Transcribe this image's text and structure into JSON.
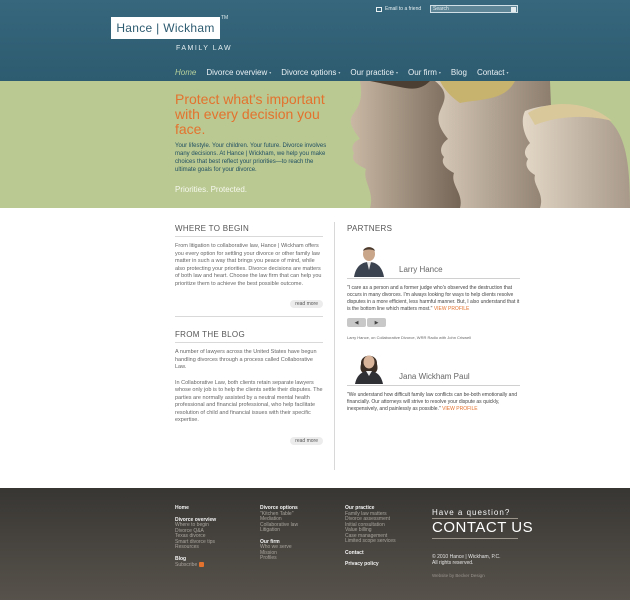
{
  "header": {
    "logo_text": "Hance | Wickham",
    "logo_tm": "TM",
    "logo_subtitle": "FAMILY LAW",
    "email_link": "Email to a friend",
    "search_placeholder": "Search"
  },
  "nav": {
    "items": [
      {
        "label": "Home"
      },
      {
        "label": "Divorce overview",
        "chevron": "▾"
      },
      {
        "label": "Divorce options",
        "chevron": "▾"
      },
      {
        "label": "Our practice",
        "chevron": "▾"
      },
      {
        "label": "Our firm",
        "chevron": "▾"
      },
      {
        "label": "Blog"
      },
      {
        "label": "Contact",
        "chevron": "▾"
      }
    ]
  },
  "hero": {
    "headline": "Protect what's important with every decision you face.",
    "body": "Your lifestyle. Your children. Your future. Divorce involves many decisions. At Hance | Wickham, we help you make choices that best reflect your priorities—to reach the ultimate goals for your divorce.",
    "tagline": "Priorities. Protected."
  },
  "where_to_begin": {
    "title": "WHERE TO BEGIN",
    "body": "From litigation to collaborative law, Hance | Wickham offers you every option for settling your divorce or other family law matter in such a way that brings you peace of mind, while also protecting your priorities. Divorce decisions are matters of both law and heart. Choose the law firm that can help you prioritize them to achieve the best possible outcome.",
    "read_more": "read more"
  },
  "blog": {
    "title": "FROM THE BLOG",
    "para1": "A number of lawyers across the United States have begun handling divorces through a process called Collaborative Law.",
    "para2": "In Collaborative Law, both clients retain separate lawyers whose only job is to help the clients settle their disputes. The parties are normally assisted by a neutral mental health professional and financial professional, who help facilitate resolution of child and financial issues with their specific expertise.",
    "read_more": "read more"
  },
  "partners": {
    "title": "PARTNERS",
    "prev": "◀",
    "next": "▶",
    "items": [
      {
        "name": "Larry Hance",
        "quote": "\"I care as a person and a former judge who's observed the destruction that occurs in many divorces. I'm always looking for ways to help clients resolve disputes in a more efficient, less harmful manner. But, I also understand that it is the bottom line which matters most.\"",
        "view_profile": "VIEW PROFILE",
        "caption": "Larry Hance, on Collaborative Divorce, WRR Radio with John Criswell"
      },
      {
        "name": "Jana Wickham Paul",
        "quote": "\"We understand how difficult family law conflicts can be-both emotionally and financially. Our attorneys will strive to resolve your dispute as quickly, inexpensively, and painlessly as possible.\"",
        "view_profile": "VIEW PROFILE"
      }
    ]
  },
  "footer": {
    "col1": {
      "home": "Home",
      "divorce_overview": "Divorce overview",
      "overview_links": [
        "Where to begin",
        "Divorce Q&A",
        "Texas divorce",
        "Smart divorce tips",
        "Resources"
      ],
      "blog": "Blog",
      "subscribe": "Subscribe"
    },
    "col2": {
      "divorce_options": "Divorce options",
      "options_links": [
        "\"Kitchen Table\"",
        "Mediation",
        "Collaborative law",
        "Litigation"
      ],
      "our_firm": "Our firm",
      "firm_links": [
        "Who we serve",
        "Mission",
        "Profiles"
      ]
    },
    "col3": {
      "our_practice": "Our practice",
      "practice_links": [
        "Family law matters",
        "Divorce assessment",
        "Initial consultation",
        "Value billing",
        "Case management",
        "Limited scope services"
      ],
      "contact": "Contact",
      "privacy": "Privacy policy"
    },
    "cta_small": "Have a question?",
    "cta_big": "CONTACT US",
    "copyright_line1": "© 2010 Hance | Wickham, P.C.",
    "copyright_line2": "All rights reserved.",
    "credit": "Website by Becker Design"
  },
  "colors": {
    "header_blue": "#2d5b70",
    "hero_green": "#bac992",
    "accent_orange": "#e3722e",
    "footer_dark": "#383633"
  }
}
